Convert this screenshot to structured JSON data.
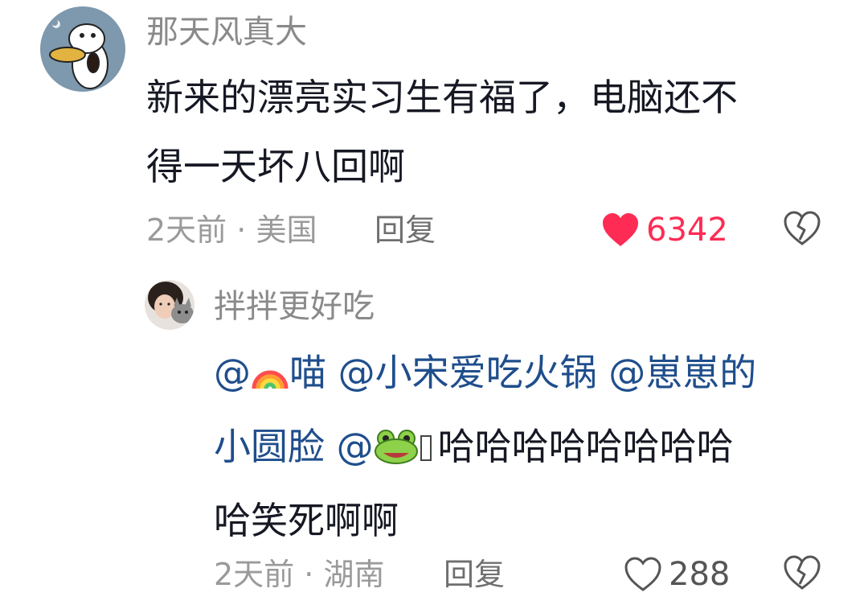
{
  "comment": {
    "username": "那天风真大",
    "text_lines": [
      "新来的漂亮实习生有福了，电脑还不",
      "得一天坏八回啊"
    ],
    "time": "2天前",
    "location": "美国",
    "reply_label": "回复",
    "like_count": "6342",
    "liked": true
  },
  "reply": {
    "username": "拌拌更好吃",
    "lines": [
      [
        {
          "text": "@",
          "mention": true
        },
        {
          "emoji": "rainbow-emoji"
        },
        {
          "text": "喵 @小宋爱吃火锅 @崽崽的",
          "mention": true
        }
      ],
      [
        {
          "text": "小圆脸 @",
          "mention": true
        },
        {
          "emoji": "frog-emoji"
        },
        {
          "tofu": true
        },
        {
          "text": "哈哈哈哈哈哈哈哈",
          "mention": false
        }
      ],
      [
        {
          "text": "哈笑死啊啊",
          "mention": false
        }
      ]
    ],
    "time": "2天前",
    "location": "湖南",
    "reply_label": "回复",
    "like_count": "288",
    "liked": false
  },
  "colors": {
    "like_active": "#fe2c55",
    "mention": "#1f4e8c",
    "text": "#161823",
    "meta": "#9a9a9a"
  }
}
